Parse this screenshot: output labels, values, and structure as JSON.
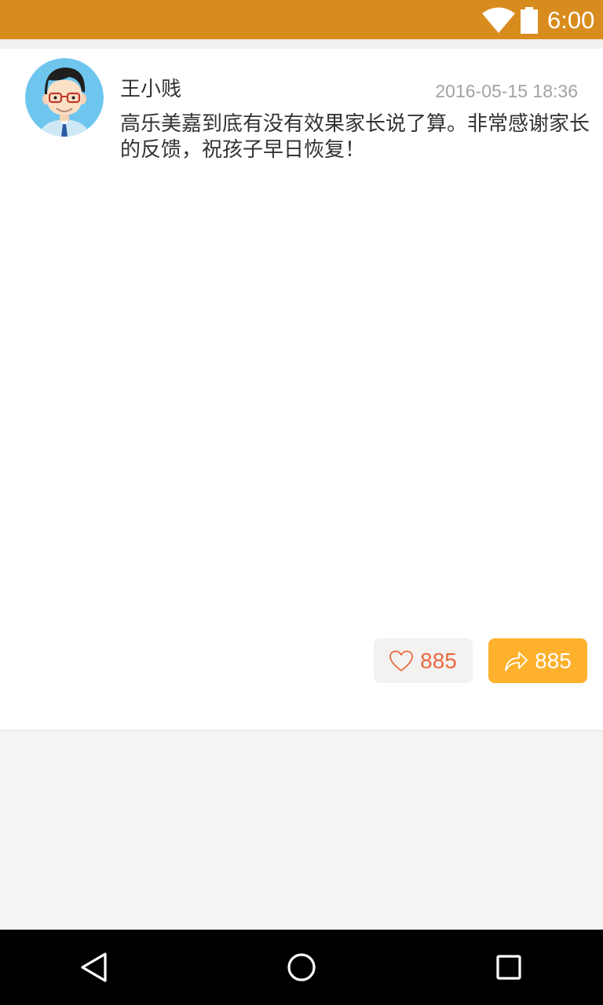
{
  "status_bar": {
    "time": "6:00",
    "background_color": "#d98c1e",
    "icons": [
      "wifi-icon",
      "battery-icon"
    ]
  },
  "post": {
    "author": "王小贱",
    "timestamp": "2016-05-15  18:36",
    "content": "高乐美嘉到底有没有效果家长说了算。非常感谢家长的反馈，祝孩子早日恢复！",
    "avatar_icon": "avatar-icon",
    "like": {
      "icon": "heart-icon",
      "count": "885",
      "color": "#e9693f"
    },
    "share": {
      "icon": "share-icon",
      "count": "885",
      "color": "#fdb12c"
    }
  },
  "nav_bar": {
    "buttons": [
      "back-icon",
      "home-icon",
      "recents-icon"
    ]
  }
}
